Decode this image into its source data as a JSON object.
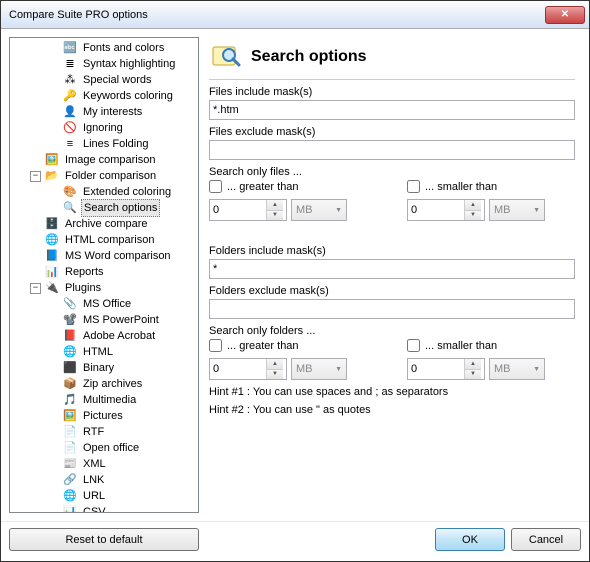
{
  "window": {
    "title": "Compare Suite PRO options"
  },
  "tree": {
    "items": [
      {
        "d": 2,
        "icon": "🔤",
        "label": "Fonts and colors"
      },
      {
        "d": 2,
        "icon": "≣",
        "label": "Syntax highlighting"
      },
      {
        "d": 2,
        "icon": "⁂",
        "label": "Special words"
      },
      {
        "d": 2,
        "icon": "🔑",
        "label": "Keywords coloring"
      },
      {
        "d": 2,
        "icon": "👤",
        "label": "My interests"
      },
      {
        "d": 2,
        "icon": "🚫",
        "label": "Ignoring"
      },
      {
        "d": 2,
        "icon": "≡",
        "label": "Lines Folding"
      },
      {
        "d": 1,
        "icon": "🖼️",
        "label": "Image comparison"
      },
      {
        "d": 1,
        "icon": "📂",
        "label": "Folder comparison",
        "expand": "−"
      },
      {
        "d": 2,
        "icon": "🎨",
        "label": "Extended coloring"
      },
      {
        "d": 2,
        "icon": "🔍",
        "label": "Search options",
        "selected": true
      },
      {
        "d": 1,
        "icon": "🗄️",
        "label": "Archive compare"
      },
      {
        "d": 1,
        "icon": "🌐",
        "label": "HTML comparison"
      },
      {
        "d": 1,
        "icon": "📘",
        "label": "MS Word comparison"
      },
      {
        "d": 1,
        "icon": "📊",
        "label": "Reports"
      },
      {
        "d": 1,
        "icon": "🔌",
        "label": "Plugins",
        "expand": "−"
      },
      {
        "d": 2,
        "icon": "📎",
        "label": "MS Office"
      },
      {
        "d": 2,
        "icon": "📽️",
        "label": "MS PowerPoint"
      },
      {
        "d": 2,
        "icon": "📕",
        "label": "Adobe Acrobat"
      },
      {
        "d": 2,
        "icon": "🌐",
        "label": "HTML"
      },
      {
        "d": 2,
        "icon": "⬛",
        "label": "Binary"
      },
      {
        "d": 2,
        "icon": "📦",
        "label": "Zip archives"
      },
      {
        "d": 2,
        "icon": "🎵",
        "label": "Multimedia"
      },
      {
        "d": 2,
        "icon": "🖼️",
        "label": "Pictures"
      },
      {
        "d": 2,
        "icon": "📄",
        "label": "RTF"
      },
      {
        "d": 2,
        "icon": "📄",
        "label": "Open office"
      },
      {
        "d": 2,
        "icon": "📰",
        "label": "XML"
      },
      {
        "d": 2,
        "icon": "🔗",
        "label": "LNK"
      },
      {
        "d": 2,
        "icon": "🌐",
        "label": "URL"
      },
      {
        "d": 2,
        "icon": "📊",
        "label": "CSV"
      }
    ]
  },
  "right": {
    "title": "Search options",
    "filesInclude": {
      "label": "Files include mask(s)",
      "value": "*.htm"
    },
    "filesExclude": {
      "label": "Files exclude mask(s)",
      "value": ""
    },
    "filesSearch": {
      "label": "Search only files ...",
      "greater": {
        "label": "... greater than",
        "value": "0",
        "unit": "MB"
      },
      "smaller": {
        "label": "... smaller than",
        "value": "0",
        "unit": "MB"
      }
    },
    "foldersInclude": {
      "label": "Folders include mask(s)",
      "value": "*"
    },
    "foldersExclude": {
      "label": "Folders exclude mask(s)",
      "value": ""
    },
    "foldersSearch": {
      "label": "Search only folders ...",
      "greater": {
        "label": "... greater than",
        "value": "0",
        "unit": "MB"
      },
      "smaller": {
        "label": "... smaller than",
        "value": "0",
        "unit": "MB"
      }
    },
    "hint1": "Hint #1 : You can use spaces and ; as separators",
    "hint2": "Hint #2 : You can use \" as quotes"
  },
  "footer": {
    "reset": "Reset to default",
    "ok": "OK",
    "cancel": "Cancel"
  }
}
